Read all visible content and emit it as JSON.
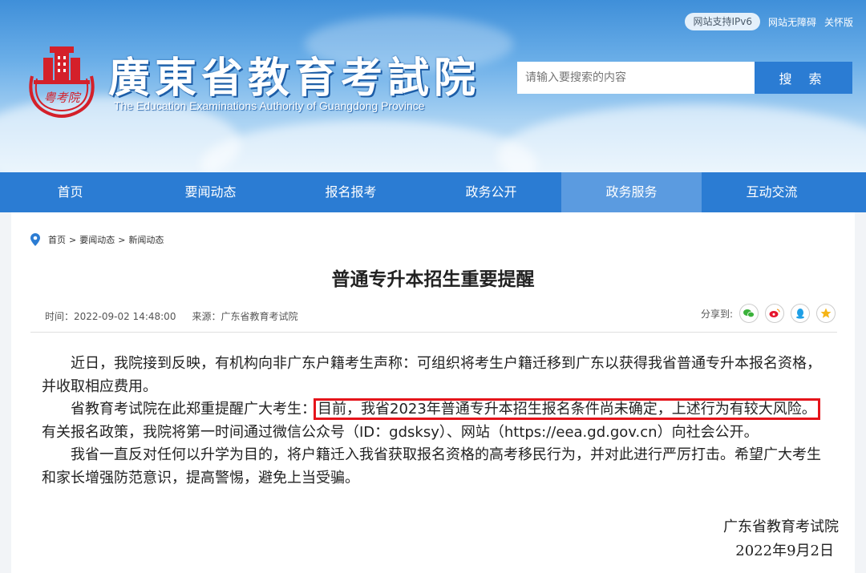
{
  "header": {
    "top_links": {
      "ipv6": "网站支持IPv6",
      "accessibility": "网站无障碍",
      "elderly": "关怀版"
    },
    "title_cn": "廣東省教育考試院",
    "title_en": "The Education Examinations Authority of Guangdong Province",
    "seal_text": "粤考院",
    "search": {
      "placeholder": "请输入要搜索的内容",
      "button": "搜 索"
    }
  },
  "nav": {
    "items": [
      "首页",
      "要闻动态",
      "报名报考",
      "政务公开",
      "政务服务",
      "互动交流"
    ],
    "active_index": 4
  },
  "breadcrumb": {
    "home": "首页",
    "sep1": ">",
    "level1": "要闻动态",
    "sep2": ">",
    "level2": "新闻动态"
  },
  "article": {
    "title": "普通专升本招生重要提醒",
    "time": "时间：2022-09-02 14:48:00",
    "source": "来源：广东省教育考试院",
    "share_label": "分享到:",
    "p1": "近日，我院接到反映，有机构向非广东户籍考生声称：可组织将考生户籍迁移到广东以获得我省普通专升本报名资格，并收取相应费用。",
    "p2_before": "省教育考试院在此郑重提醒广大考生：",
    "p2_highlight": "目前，我省2023年普通专升本招生报名条件尚未确定，上述行为有较大风险。",
    "p2_after": "有关报名政策，我院将第一时间通过微信公众号（ID：gdsksy）、网站（https://eea.gd.gov.cn）向社会公开。",
    "p3": "我省一直反对任何以升学为目的，将户籍迁入我省获取报名资格的高考移民行为，并对此进行严厉打击。希望广大考生和家长增强防范意识，提高警惕，避免上当受骗。",
    "signature": "广东省教育考试院",
    "date": "2022年9月2日"
  },
  "colors": {
    "nav_bg": "#2b7cd3",
    "nav_active": "#5b9be0",
    "highlight_border": "#e5141b",
    "seal_red": "#d4202a"
  }
}
